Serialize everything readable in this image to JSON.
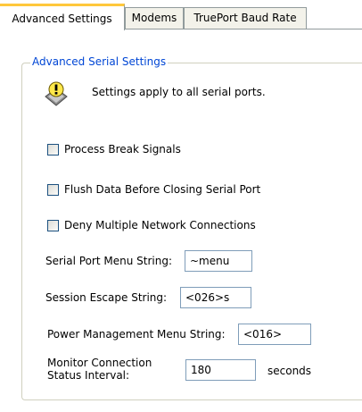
{
  "tabs": [
    {
      "label": "Advanced Settings",
      "active": true
    },
    {
      "label": "Modems",
      "active": false
    },
    {
      "label": "TruePort Baud Rate",
      "active": false
    }
  ],
  "group": {
    "title": "Advanced Serial Settings",
    "info_icon": "warning-info-icon",
    "info_text": "Settings apply to all serial ports."
  },
  "checkboxes": [
    {
      "label": "Process Break Signals",
      "checked": false
    },
    {
      "label": "Flush Data Before Closing Serial Port",
      "checked": false
    },
    {
      "label": "Deny Multiple Network Connections",
      "checked": false
    }
  ],
  "fields": {
    "serial_port_menu": {
      "label": "Serial Port Menu String:",
      "value": "~menu"
    },
    "session_escape": {
      "label": "Session Escape String:",
      "value": "<026>s"
    },
    "power_management": {
      "label": "Power Management Menu String:",
      "value": "<016>"
    },
    "monitor_interval": {
      "label_line1": "Monitor Connection",
      "label_line2": "Status Interval:",
      "value": "180",
      "unit": "seconds"
    }
  },
  "colors": {
    "group_title": "#0046d5",
    "active_tab_accent": "#ffc83c",
    "field_border": "#7f9db9",
    "checkbox_border": "#1c5180"
  }
}
